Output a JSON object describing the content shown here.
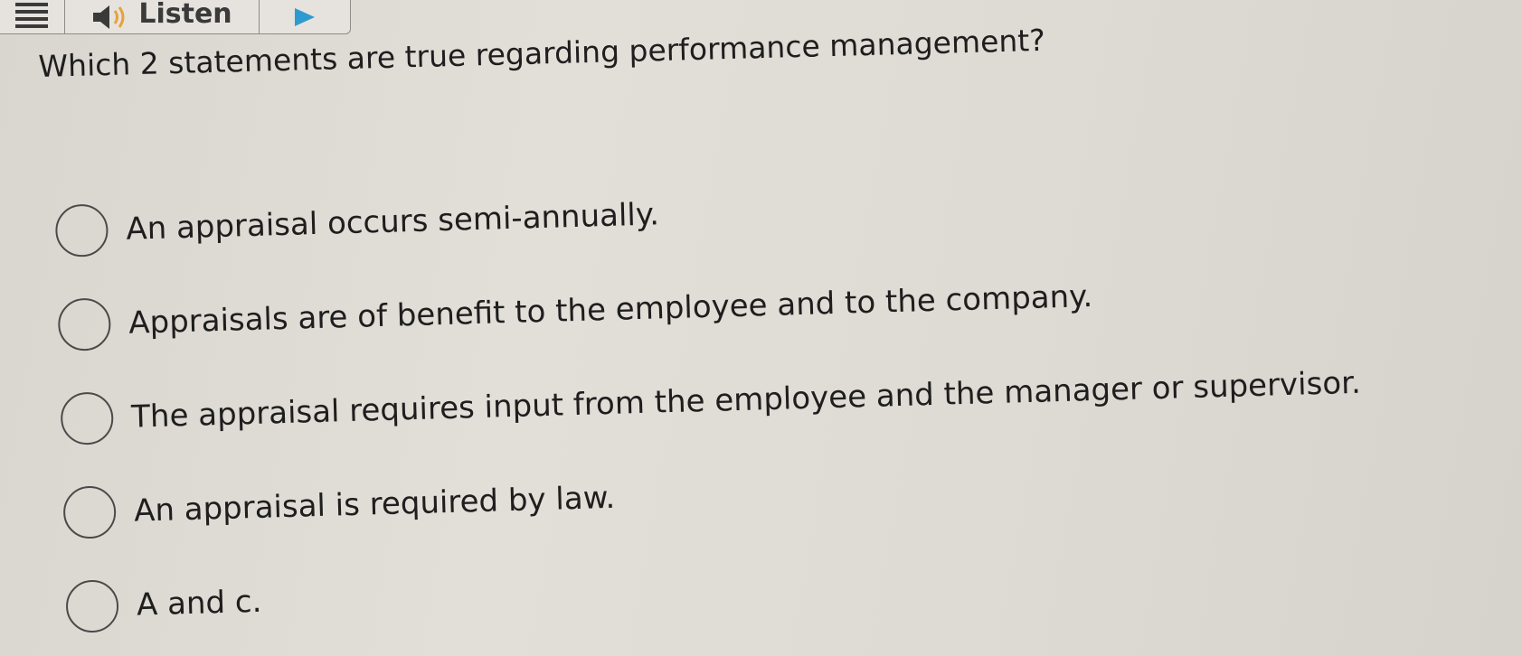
{
  "toolbar": {
    "menu_icon": "hamburger-menu-icon",
    "speaker_icon": "speaker-icon",
    "listen_label": "Listen",
    "play_icon": "play-icon"
  },
  "question": {
    "text": "Which 2 statements are true regarding performance management?"
  },
  "options": [
    {
      "label": "An appraisal occurs semi-annually."
    },
    {
      "label": "Appraisals are of benefit to the employee and to the company."
    },
    {
      "label": "The appraisal requires input from the employee and the manager or supervisor."
    },
    {
      "label": "An appraisal is required by law."
    },
    {
      "label": "A and c."
    }
  ],
  "colors": {
    "text": "#1e1e1e",
    "toolbar_border": "#8e8c88",
    "play_accent": "#2e9ad0"
  }
}
